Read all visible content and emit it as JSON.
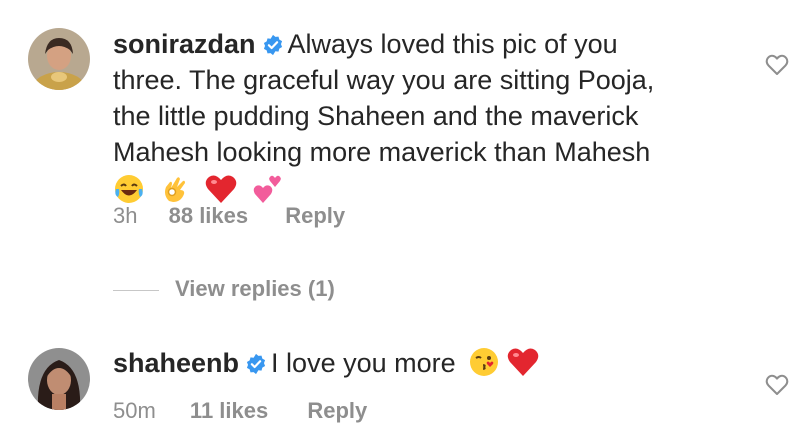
{
  "comments": [
    {
      "username": "sonirazdan",
      "text": "Always loved this pic of you three. The graceful way you are sitting Pooja, the little pudding Shaheen and the maverick Mahesh looking more maverick than Mahesh",
      "emojis": [
        "joy-emoji",
        "ok-hand-emoji",
        "red-heart-emoji",
        "two-hearts-emoji"
      ],
      "time": "3h",
      "likes": "88 likes",
      "reply": "Reply"
    },
    {
      "username": "shaheenb",
      "text": "I love you more",
      "emojis": [
        "kiss-emoji",
        "red-heart-emoji"
      ],
      "time": "50m",
      "likes": "11 likes",
      "reply": "Reply"
    }
  ],
  "view_replies": "View replies (1)",
  "colors": {
    "text": "#262626",
    "secondary": "#8e8e8e",
    "verified": "#3897f0",
    "heart_outline": "#8e8e8e"
  }
}
